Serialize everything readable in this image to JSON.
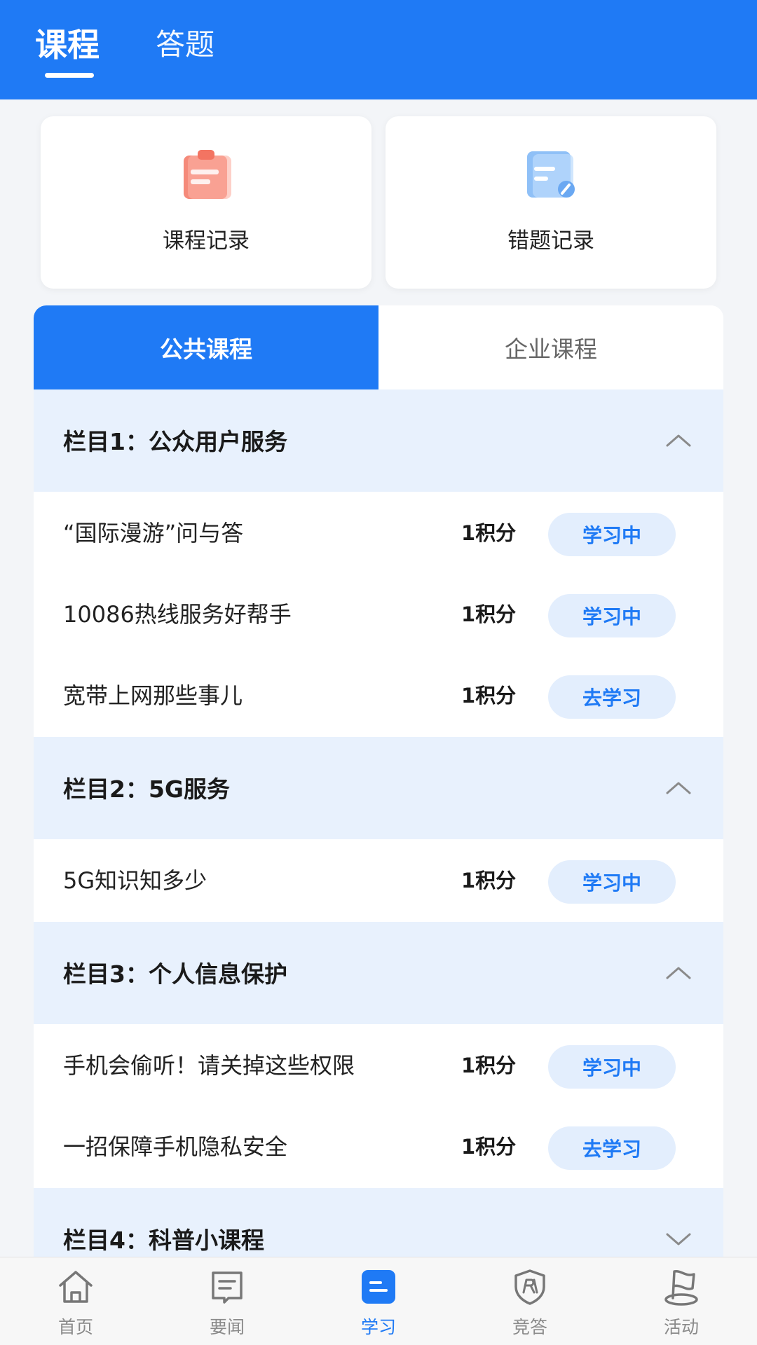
{
  "header": {
    "tabs": [
      {
        "label": "课程",
        "active": true
      },
      {
        "label": "答题",
        "active": false
      }
    ]
  },
  "records": [
    {
      "label": "课程记录",
      "icon": "clipboard-icon"
    },
    {
      "label": "错题记录",
      "icon": "document-edit-icon"
    }
  ],
  "segments": [
    {
      "label": "公共课程",
      "active": true
    },
    {
      "label": "企业课程",
      "active": false
    }
  ],
  "sections": [
    {
      "title": "栏目1：公众用户服务",
      "expanded": true,
      "items": [
        {
          "title": "“国际漫游”问与答",
          "points": "1积分",
          "status": "学习中"
        },
        {
          "title": "10086热线服务好帮手",
          "points": "1积分",
          "status": "学习中"
        },
        {
          "title": "宽带上网那些事儿",
          "points": "1积分",
          "status": "去学习"
        }
      ]
    },
    {
      "title": "栏目2：5G服务",
      "expanded": true,
      "items": [
        {
          "title": "5G知识知多少",
          "points": "1积分",
          "status": "学习中"
        }
      ]
    },
    {
      "title": "栏目3：个人信息保护",
      "expanded": true,
      "items": [
        {
          "title": "手机会偷听！请关掉这些权限",
          "points": "1积分",
          "status": "学习中"
        },
        {
          "title": "一招保障手机隐私安全",
          "points": "1积分",
          "status": "去学习"
        }
      ]
    },
    {
      "title": "栏目4：科普小课程",
      "expanded": false,
      "items": []
    }
  ],
  "bottom_nav": [
    {
      "label": "首页",
      "icon": "home-icon",
      "active": false
    },
    {
      "label": "要闻",
      "icon": "news-icon",
      "active": false
    },
    {
      "label": "学习",
      "icon": "study-icon",
      "active": true
    },
    {
      "label": "竞答",
      "icon": "pk-shield-icon",
      "active": false
    },
    {
      "label": "活动",
      "icon": "flag-icon",
      "active": false
    }
  ],
  "colors": {
    "primary": "#1f7af5",
    "section_bg": "#e8f1fd",
    "button_bg": "#e3eefd"
  }
}
